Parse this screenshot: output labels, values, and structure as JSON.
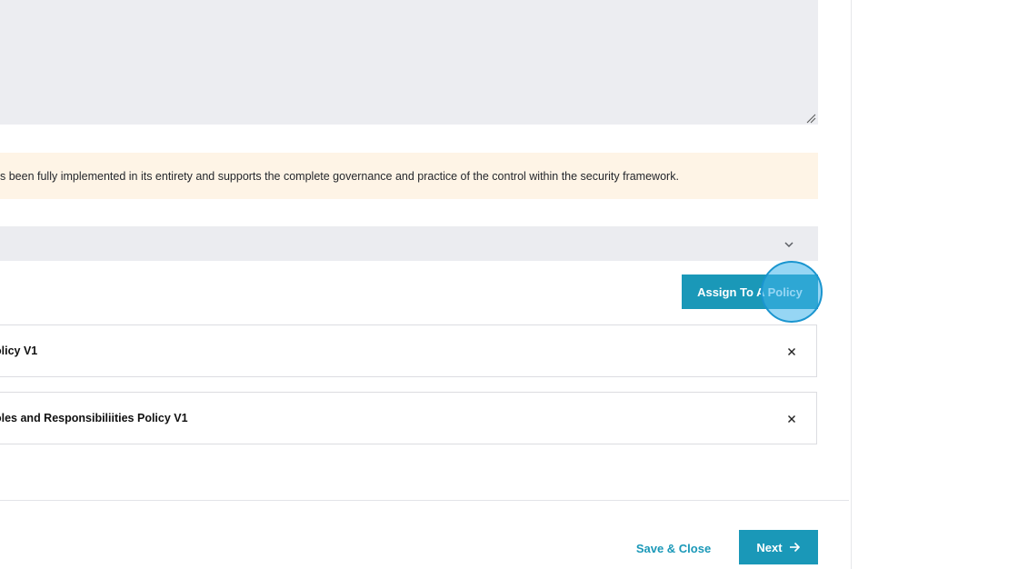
{
  "notice": {
    "text": "s been fully implemented in its entirety and supports the complete governance and practice of the control within the security framework."
  },
  "actions": {
    "assign_label": "Assign To A Policy"
  },
  "policies": [
    {
      "name": "olicy V1"
    },
    {
      "name": "oles and Responsibiliities Policy V1"
    }
  ],
  "footer": {
    "save_close_label": "Save & Close",
    "next_label": "Next"
  },
  "icons": {
    "dropdown": "chevron-down-icon",
    "remove": "close-icon",
    "next": "arrow-right-icon",
    "resize": "resize-handle-icon"
  },
  "colors": {
    "accent": "#1a98b8",
    "notice_bg": "#fef4e6",
    "field_bg": "#ecedf1"
  }
}
